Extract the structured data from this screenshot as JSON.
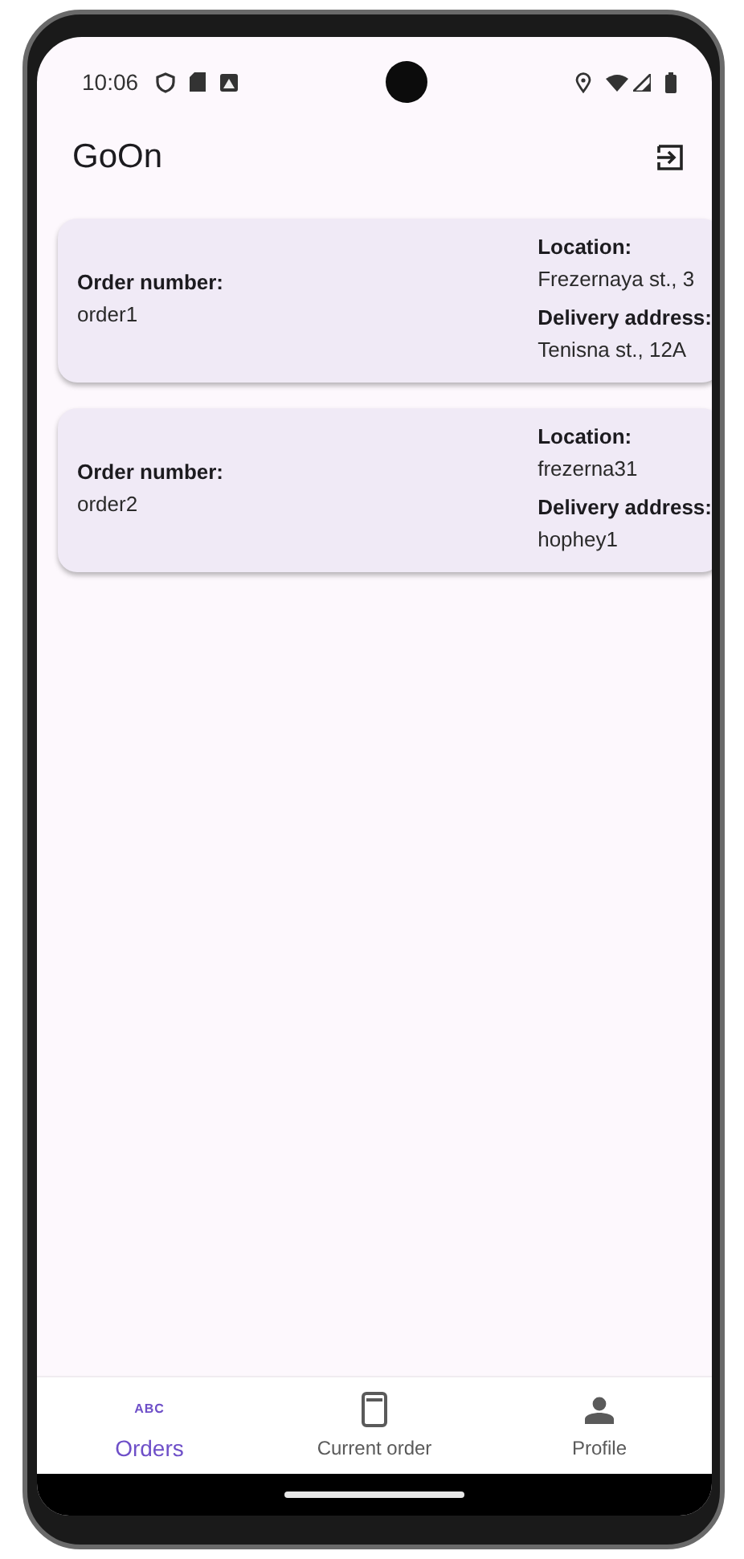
{
  "status_bar": {
    "time": "10:06"
  },
  "app_bar": {
    "title": "GoOn"
  },
  "orders": [
    {
      "order_label": "Order number:",
      "order_number": "order1",
      "location_label": "Location:",
      "location": "Frezernaya st., 3",
      "address_label": "Delivery address:",
      "address": "Tenisna st., 12A"
    },
    {
      "order_label": "Order number:",
      "order_number": "order2",
      "location_label": "Location:",
      "location": "frezerna31",
      "address_label": "Delivery address:",
      "address": "hophey1"
    }
  ],
  "bottom_nav": [
    {
      "label": "Orders",
      "kind": "abc",
      "icon_text": "ABC",
      "selected": true
    },
    {
      "label": "Current order",
      "kind": "phone",
      "selected": false
    },
    {
      "label": "Profile",
      "kind": "person",
      "selected": false
    }
  ]
}
